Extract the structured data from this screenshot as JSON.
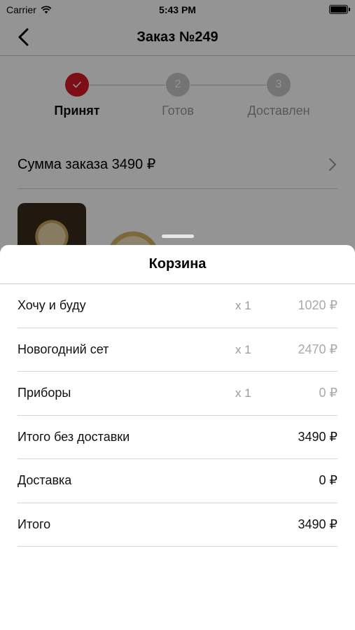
{
  "status_bar": {
    "carrier": "Carrier",
    "time": "5:43 PM"
  },
  "nav": {
    "title": "Заказ №249"
  },
  "stepper": {
    "steps": [
      {
        "number": "",
        "label": "Принят",
        "state": "done"
      },
      {
        "number": "2",
        "label": "Готов",
        "state": "pending"
      },
      {
        "number": "3",
        "label": "Доставлен",
        "state": "pending"
      }
    ]
  },
  "order": {
    "sum_label": "Сумма заказа 3490 ₽"
  },
  "cart": {
    "title": "Корзина",
    "items": [
      {
        "name": "Хочу и буду",
        "qty": "x 1",
        "price": "1020 ₽"
      },
      {
        "name": "Новогодний сет",
        "qty": "x 1",
        "price": "2470 ₽"
      },
      {
        "name": "Приборы",
        "qty": "x 1",
        "price": "0 ₽"
      }
    ],
    "totals": [
      {
        "name": "Итого без доставки",
        "price": "3490 ₽"
      },
      {
        "name": "Доставка",
        "price": "0 ₽"
      },
      {
        "name": "Итого",
        "price": "3490 ₽"
      }
    ]
  },
  "colors": {
    "accent": "#d61a27",
    "inactive_step": "#c9c9c9"
  }
}
